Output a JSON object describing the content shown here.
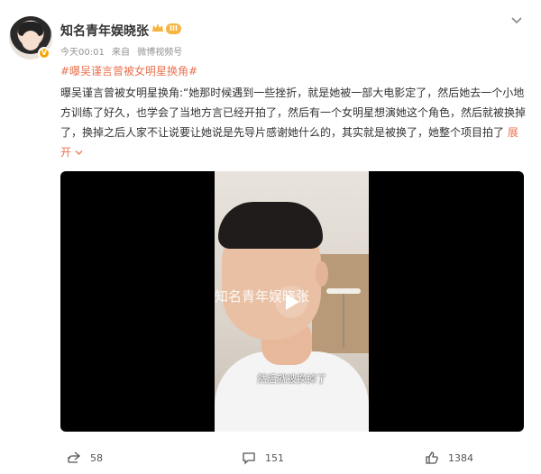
{
  "user": {
    "name": "知名青年娱晓张",
    "level_badge": "III",
    "vip_badge": "V"
  },
  "meta": {
    "time": "今天00:01",
    "source_prefix": "来自",
    "source": "微博视频号"
  },
  "post": {
    "hashtag": "#曝吴谨言曾被女明星换角#",
    "text": "曝吴谨言曾被女明星换角:“她那时候遇到一些挫折，就是她被一部大电影定了，然后她去一个小地方训练了好久，也学会了当地方言已经开拍了，然后有一个女明星想演她这个角色，然后就被换掉了，换掉之后人家不让说要让她说是先导片感谢她什么的，其实就是被换了，她整个项目拍了",
    "expand_label": "展开"
  },
  "video": {
    "watermark": "知名青年娱晓张",
    "subtitle": "然后就被换掉了"
  },
  "actions": {
    "share_count": "58",
    "comment_count": "151",
    "like_count": "1384"
  },
  "colors": {
    "accent": "#eb7350",
    "badge": "#f6b540"
  }
}
